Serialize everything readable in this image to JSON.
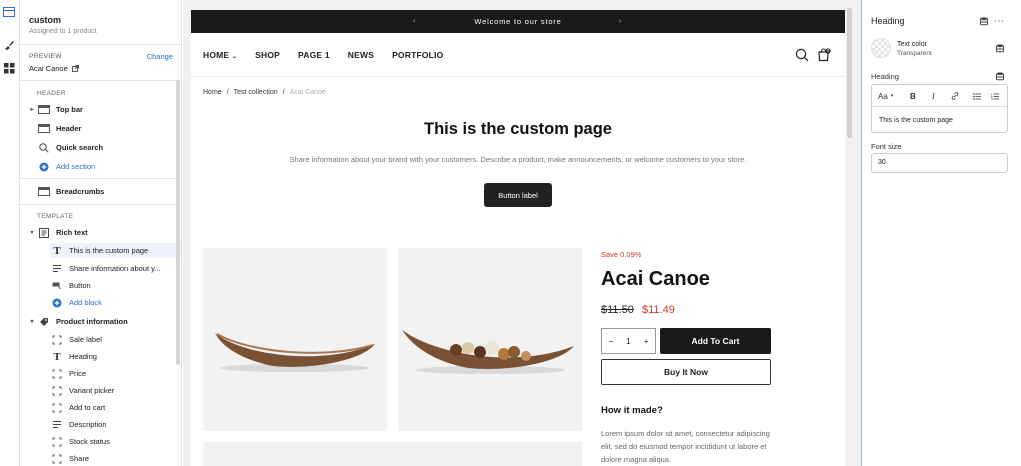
{
  "sidebar": {
    "title": "custom",
    "subtitle": "Assigned to 1 product",
    "preview_label": "PREVIEW",
    "change_label": "Change",
    "preview_product": "Acai Canoe",
    "header_section": "HEADER",
    "header_items": [
      {
        "label": "Top bar"
      },
      {
        "label": "Header"
      },
      {
        "label": "Quick search"
      },
      {
        "label": "Add section"
      }
    ],
    "breadcrumbs_label": "Breadcrumbs",
    "template_section": "TEMPLATE",
    "rich_text": {
      "label": "Rich text",
      "children": [
        "This is the custom page",
        "Share information about y...",
        "Button",
        "Add block"
      ]
    },
    "product_info": {
      "label": "Product information",
      "children": [
        "Sale label",
        "Heading",
        "Price",
        "Variant picker",
        "Add to cart",
        "Description",
        "Stock status",
        "Share"
      ]
    }
  },
  "store": {
    "announcement": "Welcome to our store",
    "nav": [
      "HOME",
      "SHOP",
      "PAGE 1",
      "NEWS",
      "PORTFOLIO"
    ],
    "cart_count": "0",
    "breadcrumbs": [
      "Home",
      "/",
      "Test collection",
      "/",
      "Acai Canoe"
    ],
    "heading": "This is the custom page",
    "lead": "Share information about your brand with your customers. Describe a product, make announcements, or welcome customers to your store.",
    "button_label": "Button label",
    "product": {
      "save_label": "Save 0.09%",
      "title": "Acai Canoe",
      "old_price": "$11.50",
      "new_price": "$11.49",
      "qty_minus": "−",
      "qty_value": "1",
      "qty_plus": "+",
      "add_to_cart": "Add To Cart",
      "buy_now": "Buy It Now",
      "how_title": "How it made?",
      "body": "Lorem ipsum dolor sit amet, consectetur adipiscing elit, sed do eiusmod tempor incididunt ut labore et dolore magna aliqua."
    }
  },
  "settings": {
    "title": "Heading",
    "text_color_label": "Text color",
    "text_color_value": "Transparent",
    "heading_label": "Heading",
    "heading_value": "This is the custom page",
    "toolbar": [
      "Aa",
      "B",
      "I"
    ],
    "font_size_label": "Font size",
    "font_size_value": "30"
  },
  "colors": {
    "accent": "#2c6ecb",
    "sale": "#d0342c",
    "dark": "#1a1a1a"
  }
}
